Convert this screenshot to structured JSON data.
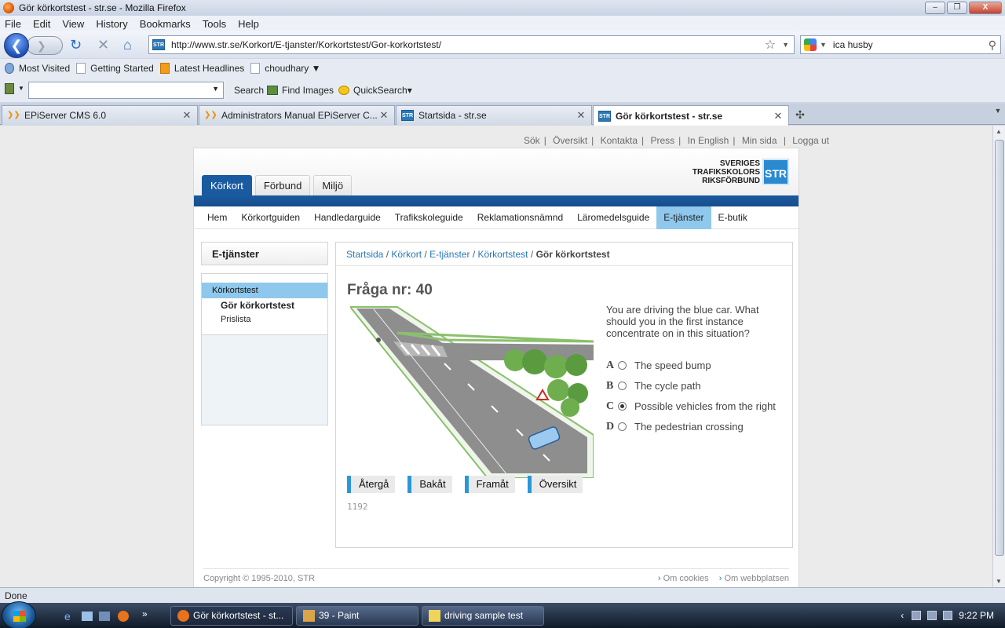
{
  "window": {
    "title": "Gör körkortstest - str.se - Mozilla Firefox",
    "min": "–",
    "max": "❐",
    "close": "X"
  },
  "menu": [
    "File",
    "Edit",
    "View",
    "History",
    "Bookmarks",
    "Tools",
    "Help"
  ],
  "nav": {
    "back": "❮",
    "forward": "❯",
    "url": "http://www.str.se/Korkort/E-tjanster/Korkortstest/Gor-korkortstest/",
    "search_value": "ica husby"
  },
  "bookmarks": [
    "Most Visited",
    "Getting Started",
    "Latest Headlines",
    "choudhary ▼"
  ],
  "toolbar2": {
    "search": "Search",
    "find_images": "Find Images",
    "quicksearch": "QuickSearch▾"
  },
  "tabs": [
    {
      "label": "EPiServer CMS 6.0",
      "icon": "episerver-icon"
    },
    {
      "label": "Administrators Manual EPiServer C...",
      "icon": "episerver-icon"
    },
    {
      "label": "Startsida - str.se",
      "icon": "str-icon"
    },
    {
      "label": "Gör körkortstest - str.se",
      "icon": "str-icon",
      "active": true
    }
  ],
  "util_links": [
    "Sök",
    "Översikt",
    "Kontakta",
    "Press",
    "In English",
    "Min sida",
    "Logga ut"
  ],
  "logo": {
    "line1": "SVERIGES",
    "line2": "TRAFIKSKOLORS",
    "line3": "RIKSFÖRBUND",
    "mark": "STR"
  },
  "main_tabs": [
    "Körkort",
    "Förbund",
    "Miljö"
  ],
  "subnav": [
    "Hem",
    "Körkortguiden",
    "Handledarguide",
    "Trafikskoleguide",
    "Reklamationsnämnd",
    "Läromedelsguide",
    "E-tjänster",
    "E-butik"
  ],
  "sidebar": {
    "heading": "E-tjänster",
    "current": "Körkortstest",
    "items": [
      "Gör körkortstest",
      "Prislista"
    ]
  },
  "breadcrumb": {
    "items": [
      "Startsida",
      "Körkort",
      "E-tjänster",
      "Körkortstest"
    ],
    "current": "Gör körkortstest",
    "sep": "/"
  },
  "question": {
    "title": "Fråga nr: 40",
    "text": "You are driving the blue car. What should you in the first instance concentrate on in this situation?",
    "answers": [
      {
        "letter": "A",
        "text": "The speed bump",
        "selected": false
      },
      {
        "letter": "B",
        "text": "The cycle path",
        "selected": false
      },
      {
        "letter": "C",
        "text": "Possible vehicles from the right",
        "selected": true
      },
      {
        "letter": "D",
        "text": "The pedestrian crossing",
        "selected": false
      }
    ],
    "buttons": [
      "Återgå",
      "Bakåt",
      "Framåt",
      "Översikt"
    ],
    "id": "1192"
  },
  "footer": {
    "copyright": "Copyright © 1995-2010, STR",
    "links": [
      "Om cookies",
      "Om webbplatsen"
    ]
  },
  "status": "Done",
  "taskbar": {
    "items": [
      "Gör körkortstest - st...",
      "39 - Paint",
      "driving sample test"
    ],
    "clock": "9:22 PM"
  }
}
